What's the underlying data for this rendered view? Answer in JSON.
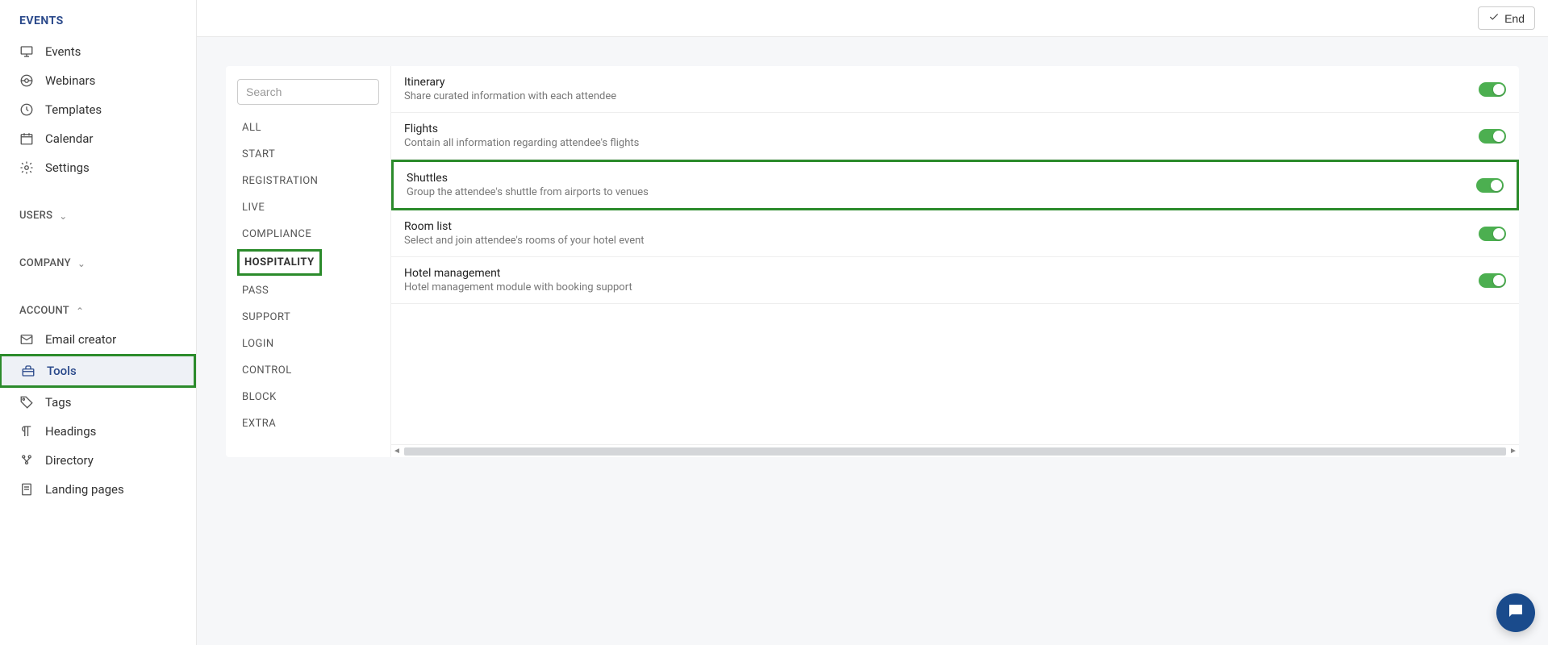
{
  "sidebar": {
    "title": "EVENTS",
    "primary": [
      {
        "label": "Events",
        "icon": "monitor"
      },
      {
        "label": "Webinars",
        "icon": "webinar"
      },
      {
        "label": "Templates",
        "icon": "template"
      },
      {
        "label": "Calendar",
        "icon": "calendar"
      },
      {
        "label": "Settings",
        "icon": "gear"
      }
    ],
    "sections": [
      {
        "label": "USERS",
        "open": false
      },
      {
        "label": "COMPANY",
        "open": false
      },
      {
        "label": "ACCOUNT",
        "open": true
      }
    ],
    "account_items": [
      {
        "label": "Email creator",
        "icon": "mail"
      },
      {
        "label": "Tools",
        "icon": "toolbox",
        "active": true,
        "highlight": true
      },
      {
        "label": "Tags",
        "icon": "tag"
      },
      {
        "label": "Headings",
        "icon": "paragraph"
      },
      {
        "label": "Directory",
        "icon": "directory"
      },
      {
        "label": "Landing pages",
        "icon": "page"
      }
    ]
  },
  "topbar": {
    "end_label": "End"
  },
  "panel": {
    "search_placeholder": "Search",
    "categories": [
      {
        "label": "ALL"
      },
      {
        "label": "START"
      },
      {
        "label": "REGISTRATION"
      },
      {
        "label": "LIVE"
      },
      {
        "label": "COMPLIANCE"
      },
      {
        "label": "HOSPITALITY",
        "active": true,
        "highlight": true
      },
      {
        "label": "PASS"
      },
      {
        "label": "SUPPORT"
      },
      {
        "label": "LOGIN"
      },
      {
        "label": "CONTROL"
      },
      {
        "label": "BLOCK"
      },
      {
        "label": "EXTRA"
      }
    ],
    "settings": [
      {
        "title": "Itinerary",
        "desc": "Share curated information with each attendee",
        "on": true
      },
      {
        "title": "Flights",
        "desc": "Contain all information regarding attendee's flights",
        "on": true
      },
      {
        "title": "Shuttles",
        "desc": "Group the attendee's shuttle from airports to venues",
        "on": true,
        "highlight": true
      },
      {
        "title": "Room list",
        "desc": "Select and join attendee's rooms of your hotel event",
        "on": true
      },
      {
        "title": "Hotel management",
        "desc": "Hotel management module with booking support",
        "on": true
      }
    ]
  }
}
